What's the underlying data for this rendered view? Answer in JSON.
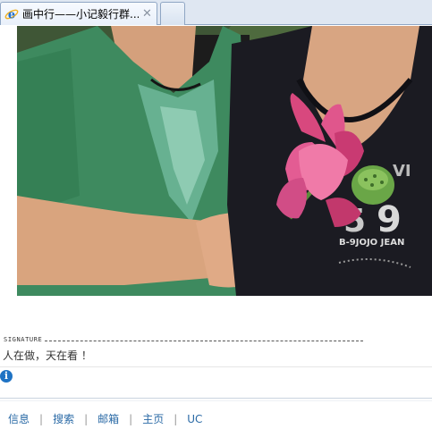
{
  "browser": {
    "active_tab_title": "画中行——小记毅行群...",
    "close_symbol": "✕",
    "icon": "ie-icon",
    "new_tab_icon": "new-tab-icon"
  },
  "post": {
    "image": "photo-two-women-holding-pink-lotus-flower",
    "signature_label": "SIGNATURE",
    "signature_text": "人在做，天在看 ！",
    "info_icon": "info-icon",
    "info_symbol": "i"
  },
  "footer": {
    "links": [
      "信息",
      "搜索",
      "邮箱",
      "主页",
      "UC"
    ],
    "separator": "|"
  }
}
